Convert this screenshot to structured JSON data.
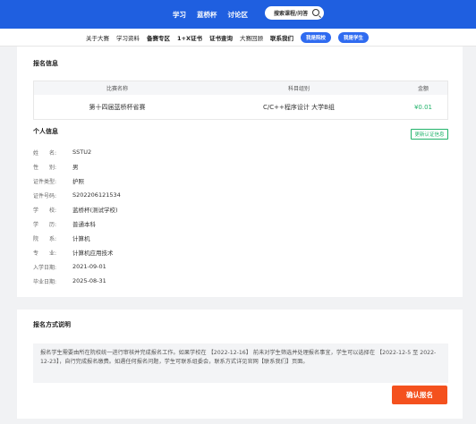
{
  "topnav": {
    "items": [
      "学习",
      "蓝桥杯",
      "讨论区"
    ],
    "search_label": "搜索课程/问答"
  },
  "subnav": {
    "items": [
      "关于大赛",
      "学习资料",
      "备赛专区",
      "1+X证书",
      "证书查询",
      "大赛回顾",
      "联系我们"
    ],
    "school_button": "我是院校",
    "student_button": "我是学生"
  },
  "registration": {
    "title": "报名信息",
    "columns": [
      "比赛名称",
      "科目组别",
      "金额"
    ],
    "row": {
      "name": "第十四届蓝桥杯省赛",
      "subject": "C/C++程序设计 大学B组",
      "amount": "¥0.01"
    }
  },
  "personal": {
    "title": "个人信息",
    "update_button": "更新认证信息",
    "fields": [
      {
        "label": "姓　　名:",
        "value": "SSTU2"
      },
      {
        "label": "性　　别:",
        "value": "男"
      },
      {
        "label": "证件类型:",
        "value": "护照"
      },
      {
        "label": "证件号码:",
        "value": "S202206121534"
      },
      {
        "label": "学　　校:",
        "value": "蓝桥杯(测试学校)"
      },
      {
        "label": "学　　历:",
        "value": "普通本科"
      },
      {
        "label": "院　　系:",
        "value": "计算机"
      },
      {
        "label": "专　　业:",
        "value": "计算机应用技术"
      },
      {
        "label": "入学日期:",
        "value": "2021-09-01"
      },
      {
        "label": "毕业日期:",
        "value": "2025-08-31"
      }
    ]
  },
  "method": {
    "title": "报名方式说明",
    "text": "报名学生需要由所在院校统一进行审核并完成报名工作。如果学校在 【2022-12-16】 前未对学生筛选并处理报名事宜，学生可以选择在 【2022-12-5 至 2022-12-23】，自行完成报名缴费。如遇任何报名问题，学生可联系组委会，联系方式详见官网【联系我们】页面。",
    "confirm_button": "确认报名"
  },
  "colors": {
    "brand": "#1f5fe0",
    "accent": "#f4511e",
    "success": "#21b36b"
  }
}
